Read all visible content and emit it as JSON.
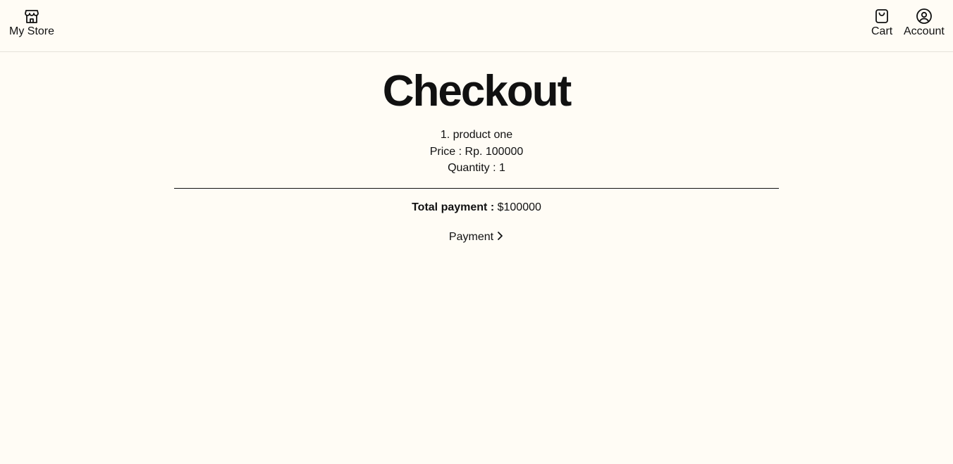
{
  "header": {
    "store_label": "My Store",
    "cart_label": "Cart",
    "account_label": "Account"
  },
  "page": {
    "title": "Checkout"
  },
  "order": {
    "item_line": "1. product one",
    "price_line": "Price : Rp. 100000",
    "quantity_line": "Quantity : 1"
  },
  "summary": {
    "total_label": "Total payment :",
    "total_value": "$100000"
  },
  "actions": {
    "payment_label": "Payment"
  },
  "icons": {
    "store": "store-icon",
    "cart": "shopping-bag-icon",
    "account": "user-circle-icon",
    "payment": "chevron-right-icon"
  },
  "colors": {
    "background": "#fffcf5",
    "text": "#111111"
  }
}
